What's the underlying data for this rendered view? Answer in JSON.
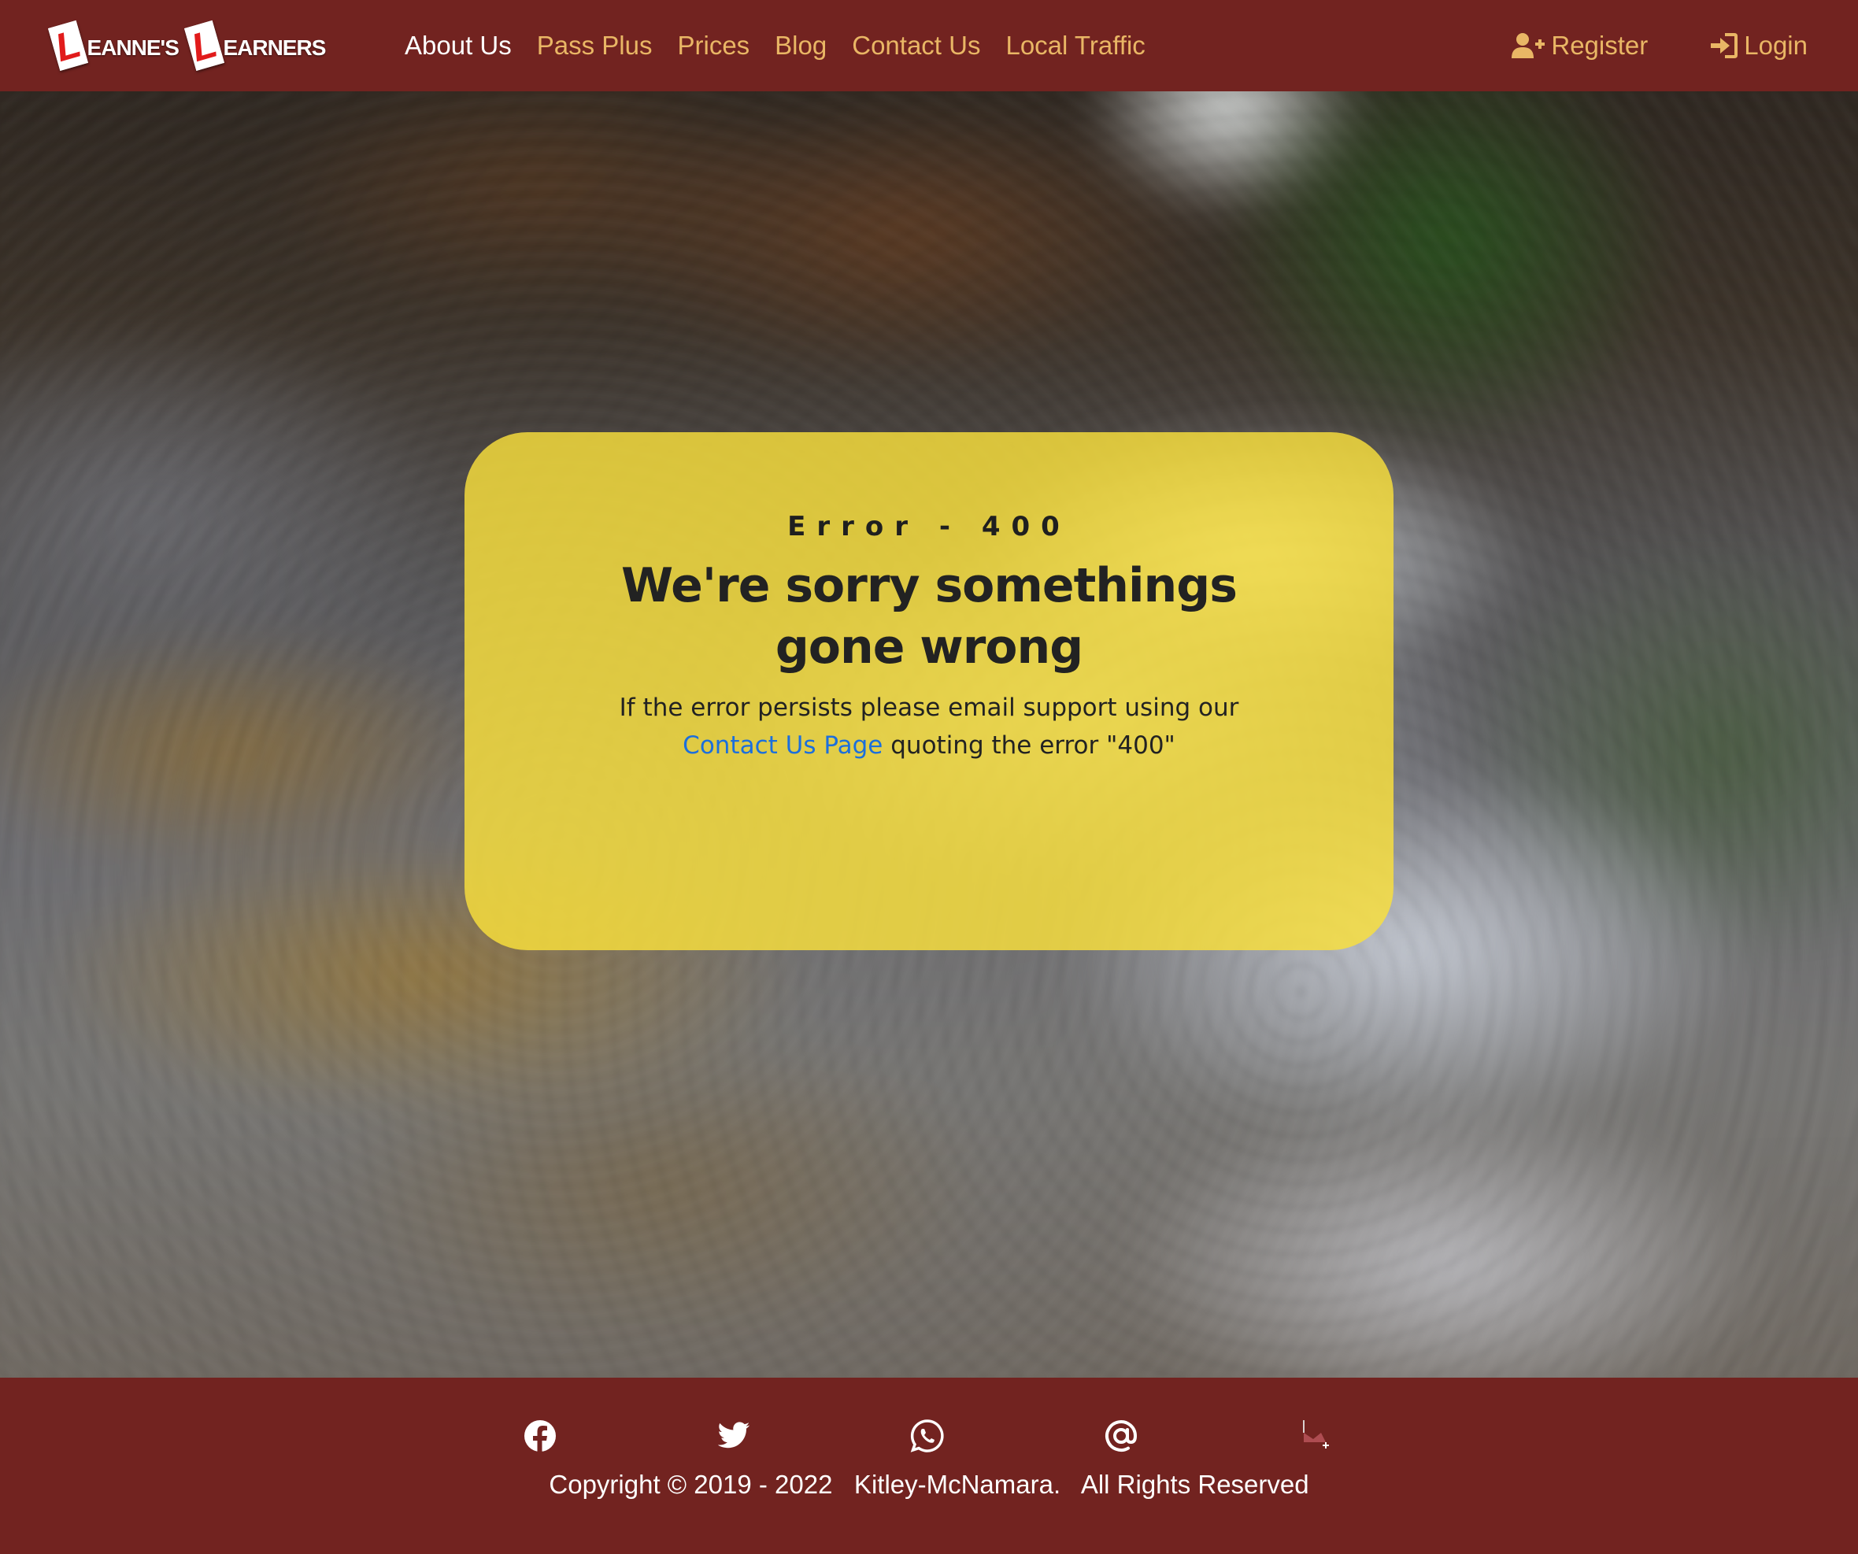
{
  "brand": {
    "plate_letter": "L",
    "word1": "EANNE'S",
    "word2": "EARNERS"
  },
  "nav": {
    "links": [
      {
        "label": "About Us"
      },
      {
        "label": "Pass Plus"
      },
      {
        "label": "Prices"
      },
      {
        "label": "Blog"
      },
      {
        "label": "Contact Us"
      },
      {
        "label": "Local Traffic"
      }
    ],
    "register": "Register",
    "login": "Login"
  },
  "error": {
    "code": "Error - 400",
    "title": "We're sorry somethings gone wrong",
    "text_before": "If the error persists please email support using our ",
    "link": "Contact Us Page",
    "text_after": " quoting the error \"400\""
  },
  "footer": {
    "social_icons": [
      "facebook-icon",
      "twitter-icon",
      "whatsapp-icon",
      "email-at-icon",
      "broken-image-icon"
    ],
    "copyright": "Copyright © 2019 - 2022   Kitley-McNamara.   All Rights Reserved"
  },
  "colors": {
    "navbar_bg": "#722320",
    "nav_link": "#e9b665",
    "nav_link_active": "#ffffff",
    "card_bg": "#fae03c",
    "link": "#1c6fdc"
  }
}
